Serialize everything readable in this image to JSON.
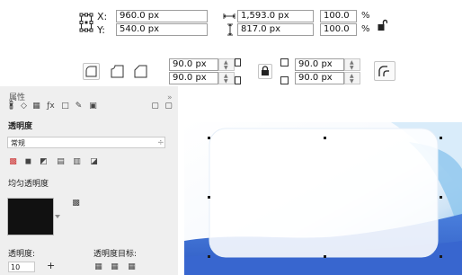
{
  "transform_bar": {
    "x_label": "X:",
    "x_value": "960.0 px",
    "y_label": "Y:",
    "y_value": "540.0 px",
    "w_value": "1,593.0 px",
    "h_value": "817.0 px",
    "scale_w": "100.0",
    "scale_h": "100.0",
    "percent": "%"
  },
  "corner_bar": {
    "radius_tl": "90.0 px",
    "radius_bl": "90.0 px",
    "radius_tr": "90.0 px",
    "radius_br": "90.0 px"
  },
  "panel": {
    "header": "属性",
    "section_title": "透明度",
    "mode_value": "常规",
    "uniform_label": "均匀透明度",
    "opacity_label": "透明度:",
    "target_label": "透明度目标:",
    "opacity_value": "10",
    "plus": "+",
    "dropdown_arrow": "÷",
    "swatch_color": "#111111"
  },
  "icons": {
    "position_icon": "anchor-grid-icon",
    "width_icon": "width-arrows-icon",
    "height_icon": "height-arrows-icon",
    "lock_ratio": "lock-open-icon",
    "lock_corners": "lock-icon",
    "corner_round": "round-corner-icon",
    "corner_scallop": "scallop-corner-icon",
    "corner_chamfer": "chamfer-corner-icon",
    "relative_scale": "relative-corner-scale-icon"
  }
}
